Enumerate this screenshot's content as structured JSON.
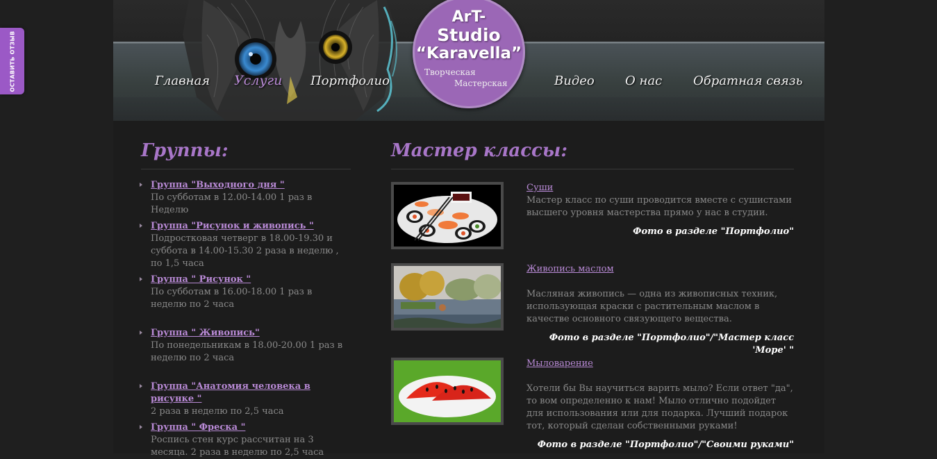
{
  "feedback_tab": {
    "label": "ОСТАВИТЬ ОТЗЫВ"
  },
  "logo": {
    "line1": "ArT-",
    "line2": "Studio",
    "line3": "“Karavella”",
    "sub1": "Творческая",
    "sub2": "Мастерская"
  },
  "nav": {
    "home": "Главная",
    "services": "Услуги",
    "portfolio": "Портфолио",
    "video": "Видео",
    "about": "О нас",
    "feedback": "Обратная связь"
  },
  "groups": {
    "heading": "Группы:",
    "items": [
      {
        "title": "Группа \"Выходного дня \"",
        "desc": "По субботам в 12.00-14.00 1 раз в Неделю"
      },
      {
        "title": "Группа \"Рисунок и живопись \"",
        "desc": "Подростковая четверг в 18.00-19.30 и суббота в 14.00-15.30 2 раза в неделю , по 1,5 часа"
      },
      {
        "title": "Группа \" Рисунок \"",
        "desc": "По субботам в 16.00-18.00 1 раз в неделю по 2 часа"
      },
      {
        "title": "Группа \" Живопись\"",
        "desc": "По понедельникам в 18.00-20.00 1 раз в неделю по 2 часа"
      },
      {
        "title": "Группа \"Анатомия человека в рисунке \"",
        "desc": "2 раза в неделю по 2,5 часа"
      },
      {
        "title": "Группа \" Фреска \"",
        "desc": "Роспись стен курс рассчитан на 3 месяца. 2 раза в неделю по 2,5 часа"
      }
    ]
  },
  "master_classes": {
    "heading": "Мастер классы:",
    "items": [
      {
        "title": "Суши",
        "desc": "Мастер класс по суши проводится вместе с сушистами высшего уровня мастерства прямо у нас в студии.",
        "note": "Фото в разделе \"Портфолио\""
      },
      {
        "title": "Живопись маслом ",
        "desc": "Масляная живопись — одна из живописных техник, использующая краски с растительным маслом в качестве основного связующего вещества.",
        "note": "Фото в разделе \"Портфолио\"/\"Мастер класс 'Море' \""
      },
      {
        "title": "Мыловарение",
        "desc": "Хотели бы Вы научиться варить мыло? Если ответ \"да\", то вом определенно к нам! Мыло отлично подойдет для использования или для подарка. Лучший подарок тот, который сделан собственными руками!",
        "note": "Фото в разделе \"Портфолио\"/\"Своими руками\""
      }
    ]
  },
  "colors": {
    "accent": "#b98ad6",
    "logo_bg": "#9b67b6",
    "feedback_tab": "#9b59c6",
    "page_bg": "#1c1c1c"
  }
}
